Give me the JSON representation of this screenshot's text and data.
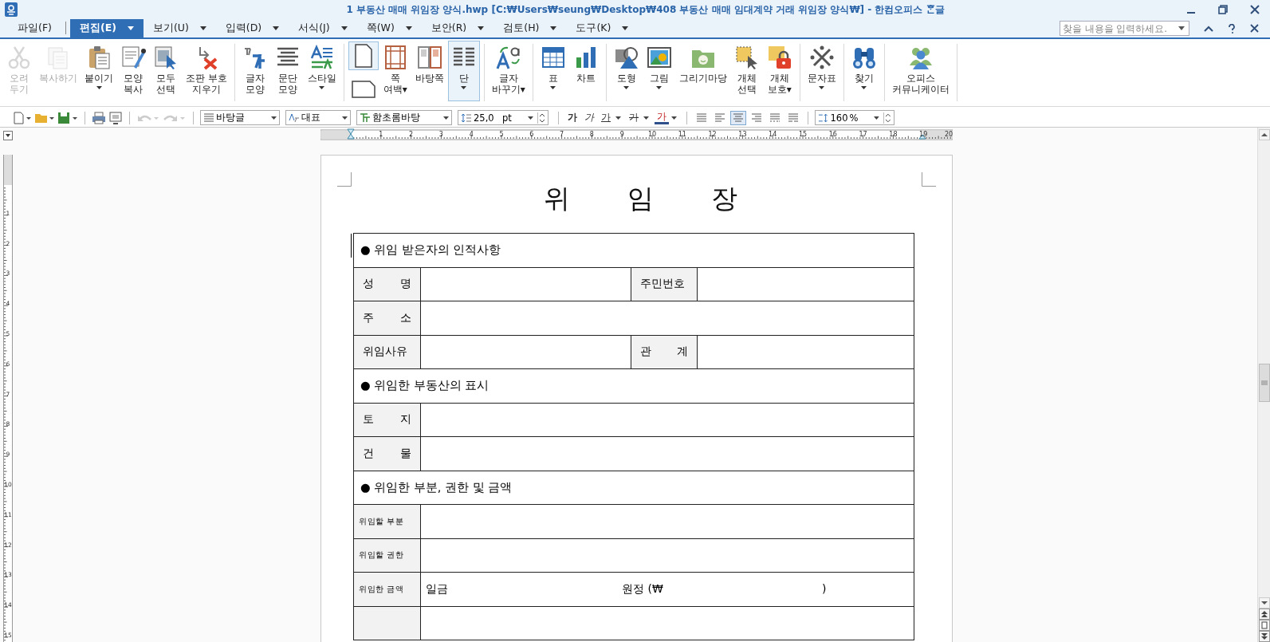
{
  "window": {
    "title": "1 부동산 매매 위임장 양식.hwp [C:₩Users₩seung₩Desktop₩408 부동산 매매 임대계약 거래 위임장 양식₩] - 한컴오피스 ᄒᆞᆫ글"
  },
  "menu": [
    {
      "label": "파일(F)",
      "selected": false,
      "dropdown": false
    },
    {
      "label": "편집(E)",
      "selected": true,
      "dropdown": true
    },
    {
      "label": "보기(U)",
      "selected": false,
      "dropdown": true
    },
    {
      "label": "입력(D)",
      "selected": false,
      "dropdown": true
    },
    {
      "label": "서식(J)",
      "selected": false,
      "dropdown": true
    },
    {
      "label": "쪽(W)",
      "selected": false,
      "dropdown": true
    },
    {
      "label": "보안(R)",
      "selected": false,
      "dropdown": true
    },
    {
      "label": "검토(H)",
      "selected": false,
      "dropdown": true
    },
    {
      "label": "도구(K)",
      "selected": false,
      "dropdown": true
    }
  ],
  "search": {
    "placeholder": "찾을 내용을 입력하세요."
  },
  "ribbon": [
    {
      "items": [
        {
          "kind": "button",
          "lines": [
            "오려",
            "두기"
          ],
          "disabled": true,
          "dropdown": false,
          "selected": false
        },
        {
          "kind": "button",
          "lines": [
            "복사하기"
          ],
          "disabled": true,
          "dropdown": false,
          "selected": false
        },
        {
          "kind": "button",
          "lines": [
            "붙이기"
          ],
          "disabled": false,
          "dropdown": true,
          "selected": false
        },
        {
          "kind": "button",
          "lines": [
            "모양",
            "복사"
          ],
          "disabled": false,
          "dropdown": false,
          "selected": false
        },
        {
          "kind": "button",
          "lines": [
            "모두",
            "선택"
          ],
          "disabled": false,
          "dropdown": false,
          "selected": false
        },
        {
          "kind": "button",
          "lines": [
            "조판 부호",
            "지우기"
          ],
          "disabled": false,
          "dropdown": false,
          "selected": false
        }
      ]
    },
    {
      "items": [
        {
          "kind": "button",
          "lines": [
            "글자",
            "모양"
          ],
          "disabled": false,
          "dropdown": false,
          "selected": false
        },
        {
          "kind": "button",
          "lines": [
            "문단",
            "모양"
          ],
          "disabled": false,
          "dropdown": false,
          "selected": false
        },
        {
          "kind": "button",
          "lines": [
            "스타일"
          ],
          "disabled": false,
          "dropdown": true,
          "selected": false
        }
      ]
    },
    {
      "items": [
        {
          "kind": "orientation",
          "options": [
            {
              "selected": true
            },
            {
              "selected": false
            }
          ]
        },
        {
          "kind": "button",
          "lines": [
            "쪽",
            "여백▾"
          ],
          "disabled": false,
          "dropdown": false,
          "selected": false
        },
        {
          "kind": "button",
          "lines": [
            "바탕쪽"
          ],
          "disabled": false,
          "dropdown": false,
          "selected": false
        },
        {
          "kind": "button",
          "lines": [
            "단"
          ],
          "disabled": false,
          "dropdown": true,
          "selected": true
        }
      ]
    },
    {
      "items": [
        {
          "kind": "button",
          "lines": [
            "글자",
            "바꾸기▾"
          ],
          "disabled": false,
          "dropdown": false,
          "selected": false
        }
      ]
    },
    {
      "items": [
        {
          "kind": "button",
          "lines": [
            "표"
          ],
          "disabled": false,
          "dropdown": true,
          "selected": false
        },
        {
          "kind": "button",
          "lines": [
            "차트"
          ],
          "disabled": false,
          "dropdown": false,
          "selected": false
        }
      ]
    },
    {
      "items": [
        {
          "kind": "button",
          "lines": [
            "도형"
          ],
          "disabled": false,
          "dropdown": true,
          "selected": false
        },
        {
          "kind": "button",
          "lines": [
            "그림"
          ],
          "disabled": false,
          "dropdown": true,
          "selected": false
        },
        {
          "kind": "button",
          "lines": [
            "그리기마당"
          ],
          "disabled": false,
          "dropdown": false,
          "selected": false
        },
        {
          "kind": "button",
          "lines": [
            "개체",
            "선택"
          ],
          "disabled": false,
          "dropdown": false,
          "selected": false
        },
        {
          "kind": "button",
          "lines": [
            "개체",
            "보호▾"
          ],
          "disabled": false,
          "dropdown": false,
          "selected": false
        }
      ]
    },
    {
      "items": [
        {
          "kind": "button",
          "lines": [
            "문자표"
          ],
          "disabled": false,
          "dropdown": true,
          "selected": false
        }
      ]
    },
    {
      "items": [
        {
          "kind": "button",
          "lines": [
            "찾기"
          ],
          "disabled": false,
          "dropdown": true,
          "selected": false
        }
      ]
    },
    {
      "items": [
        {
          "kind": "button",
          "lines": [
            "오피스",
            "커뮤니케이터"
          ],
          "disabled": false,
          "dropdown": false,
          "selected": false
        }
      ]
    }
  ],
  "toolbar": {
    "undo": {
      "disabled": true
    },
    "redo": {
      "disabled": true
    },
    "style": "바탕글",
    "language": "대표",
    "font": "함초롬바탕",
    "size": "25,0",
    "size_unit": "pt",
    "char_buttons": [
      {
        "text": "가",
        "kind": "bold"
      },
      {
        "text": "가",
        "kind": "italic"
      },
      {
        "text": "가",
        "kind": "underline"
      },
      {
        "text": "가",
        "kind": "strike"
      },
      {
        "text": "가",
        "kind": "color"
      }
    ],
    "align": [
      {
        "selected": false
      },
      {
        "selected": false
      },
      {
        "selected": true
      },
      {
        "selected": false
      },
      {
        "selected": false
      },
      {
        "selected": false
      }
    ],
    "line_spacing": "160",
    "line_spacing_unit": "%"
  },
  "ruler": {
    "marks": [
      "1",
      "2",
      "3",
      "4",
      "5",
      "6",
      "7",
      "8",
      "9",
      "10",
      "11",
      "12",
      "13",
      "14",
      "15",
      "16",
      "17",
      "18",
      "19",
      "20"
    ]
  },
  "vruler": {
    "marks": [
      "1",
      "2",
      "3",
      "4",
      "5",
      "6",
      "7",
      "8",
      "9",
      "10",
      "11",
      "12",
      "13",
      "14",
      "15"
    ]
  },
  "document": {
    "title": "위 임 장",
    "rows": [
      {
        "kind": "section",
        "text": "● 위임 받은자의 인적사항"
      },
      {
        "kind": "quad",
        "labels": [
          "성 명",
          "주민번호"
        ]
      },
      {
        "kind": "wide",
        "label": "주 소",
        "small": false
      },
      {
        "kind": "quad",
        "labels": [
          "위임사유",
          "관 계"
        ]
      },
      {
        "kind": "section",
        "text": "● 위임한 부동산의 표시"
      },
      {
        "kind": "wide",
        "label": "토 지",
        "small": false
      },
      {
        "kind": "wide",
        "label": "건 물",
        "small": false
      },
      {
        "kind": "section",
        "text": "● 위임한 부분, 권한 및 금액"
      },
      {
        "kind": "wide",
        "label": "위임할 부분",
        "small": true
      },
      {
        "kind": "wide",
        "label": "위임할 권한",
        "small": true
      },
      {
        "kind": "amount",
        "label": "위임한 금액",
        "small": true,
        "parts": [
          "일금",
          "원정 (₩",
          ")"
        ]
      },
      {
        "kind": "wide"
      }
    ]
  }
}
